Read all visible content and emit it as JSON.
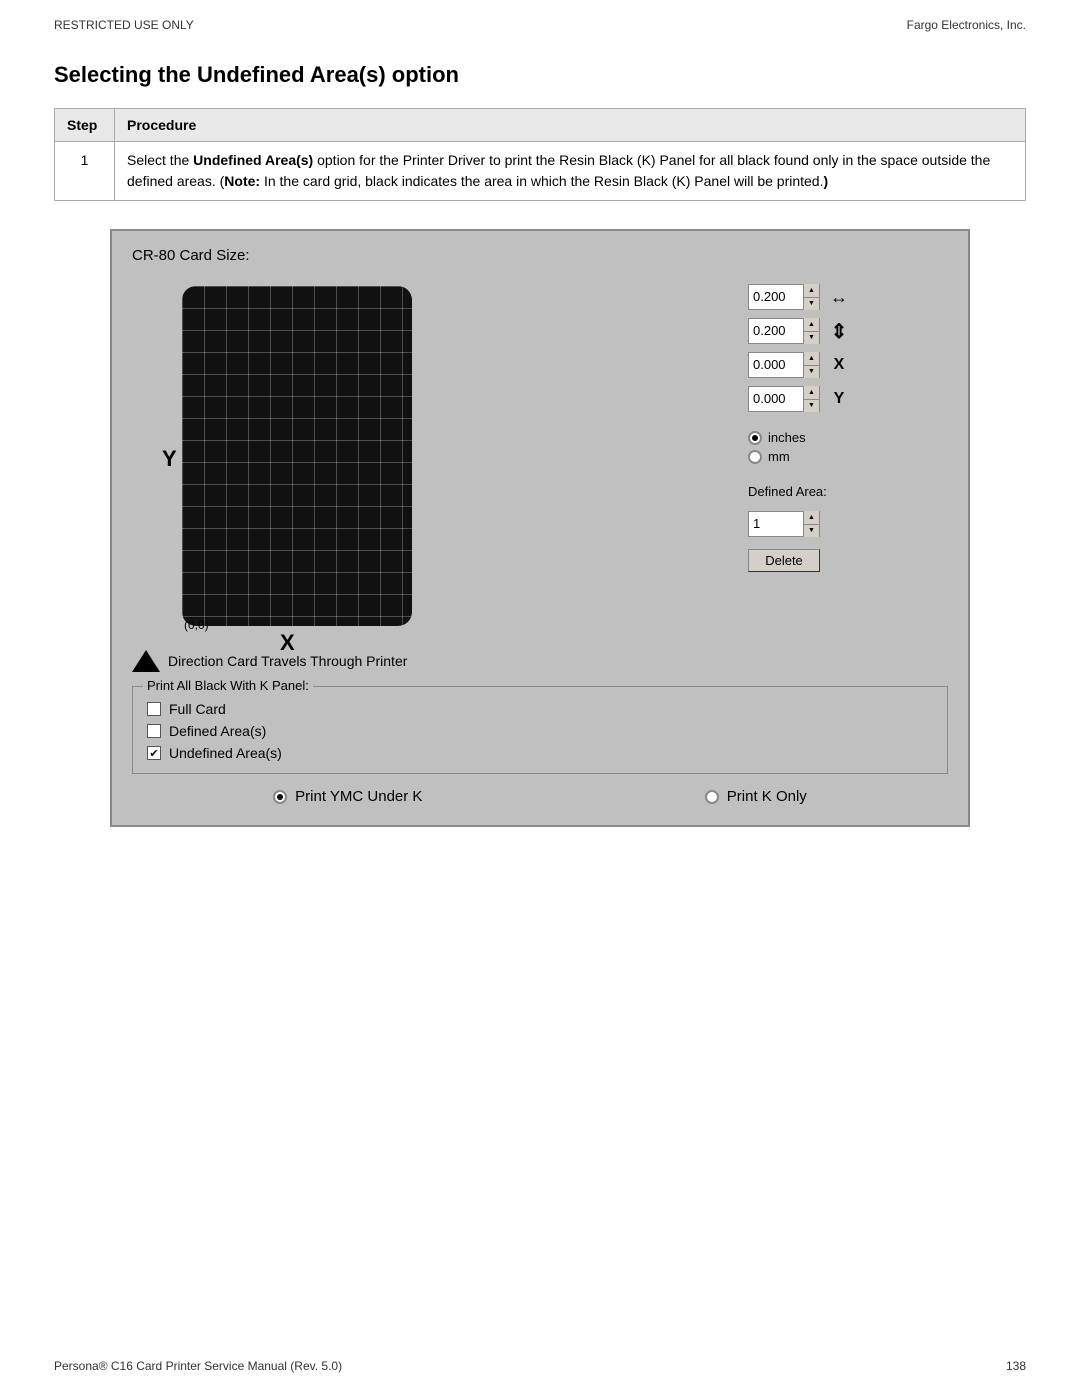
{
  "header": {
    "left": "RESTRICTED USE ONLY",
    "right": "Fargo Electronics, Inc."
  },
  "title": "Selecting the Undefined Area(s) option",
  "table": {
    "col1": "Step",
    "col2": "Procedure",
    "rows": [
      {
        "step": "1",
        "procedure_pre": "Select the ",
        "procedure_bold": "Undefined Area(s)",
        "procedure_mid": " option for the Printer Driver to print the Resin Black (K) Panel for all black found only in the space outside the defined areas. (",
        "procedure_note_bold": "Note:",
        "procedure_note_end": " In the card grid, black indicates the area in which the Resin Black (K) Panel will be printed.)"
      }
    ]
  },
  "ui": {
    "title": "CR-80 Card Size:",
    "y_label": "Y",
    "x_label": "X",
    "origin_label": "(0,0)",
    "direction_text": "Direction Card Travels Through Printer",
    "spinboxes": [
      {
        "value": "0.200",
        "icon": "↔",
        "label": "width-icon"
      },
      {
        "value": "0.200",
        "icon": "↕",
        "label": "height-icon"
      },
      {
        "value": "0.000",
        "icon": "X",
        "label": "x-icon"
      },
      {
        "value": "0.000",
        "icon": "Y",
        "label": "y-icon"
      }
    ],
    "radio_inches": "inches",
    "radio_mm": "mm",
    "radio_inches_checked": true,
    "radio_mm_checked": false,
    "defined_area_label": "Defined Area:",
    "defined_area_value": "1",
    "delete_btn": "Delete",
    "print_black_legend": "Print All Black With K Panel:",
    "checkboxes": [
      {
        "label": "Full Card",
        "checked": false
      },
      {
        "label": "Defined Area(s)",
        "checked": false
      },
      {
        "label": "Undefined Area(s)",
        "checked": true
      }
    ],
    "bottom_radio1": "Print YMC Under K",
    "bottom_radio1_checked": true,
    "bottom_radio2": "Print K Only",
    "bottom_radio2_checked": false
  },
  "footer": {
    "left": "Persona® C16 Card Printer Service Manual (Rev. 5.0)",
    "right": "138"
  }
}
